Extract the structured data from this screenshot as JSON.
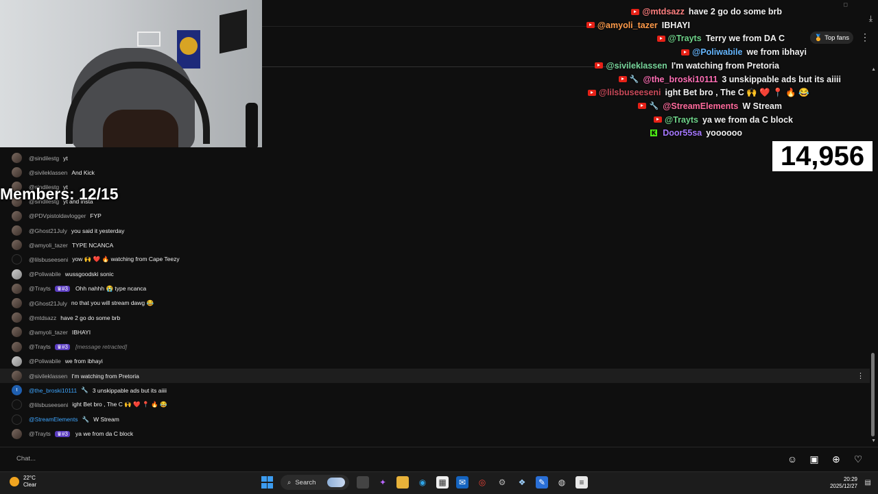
{
  "overlay": {
    "rows": [
      {
        "icon": "yt",
        "wrench": false,
        "name": "@mtdsazz",
        "name_color": "#ff8080",
        "text": "have 2 go do some brb"
      },
      {
        "icon": "yt",
        "wrench": false,
        "name": "@amyoli_tazer",
        "name_color": "#ff9b4a",
        "text": "IBHAYI"
      },
      {
        "icon": "yt",
        "wrench": false,
        "name": "@Trayts",
        "name_color": "#6fd38a",
        "text": "Terry we from DA C"
      },
      {
        "icon": "yt",
        "wrench": false,
        "name": "@Poliwabile",
        "name_color": "#66b7ff",
        "text": "we from ibhayi"
      },
      {
        "icon": "yt",
        "wrench": false,
        "name": "@sivileklassen",
        "name_color": "#77d49a",
        "text": "I'm watching from Pretoria"
      },
      {
        "icon": "yt",
        "wrench": true,
        "name": "@the_broski10111",
        "name_color": "#ff6fb5",
        "text": "3 unskippable ads but its aiiii"
      },
      {
        "icon": "yt",
        "wrench": false,
        "name": "@lilsbuseeseni",
        "name_color": "#c94a5a",
        "text": "ight Bet bro , The C 🙌 ❤️ 📍 🔥 😂"
      },
      {
        "icon": "yt",
        "wrench": true,
        "name": "@StreamElements",
        "name_color": "#ff6b9d",
        "text": "W Stream"
      },
      {
        "icon": "yt",
        "wrench": false,
        "name": "@Trayts",
        "name_color": "#6fd38a",
        "text": "ya we from da C block"
      },
      {
        "icon": "kick",
        "wrench": false,
        "name": "Door55sa",
        "name_color": "#a678ff",
        "text": "yoooooo"
      }
    ],
    "top_fans_label": "Top fans",
    "viewer_count": "14,956",
    "members_label": "Members: 12/15"
  },
  "chat": {
    "messages": [
      {
        "avatar": "photo",
        "author": "@sindilestg",
        "author_style": "grey",
        "badge": "",
        "wrench": false,
        "text": "yt",
        "italic": false
      },
      {
        "avatar": "photo",
        "author": "@sivileklassen",
        "author_style": "grey",
        "badge": "",
        "wrench": false,
        "text": "And Kick",
        "italic": false
      },
      {
        "avatar": "photo",
        "author": "@sindilestg",
        "author_style": "grey",
        "badge": "",
        "wrench": false,
        "text": "yt",
        "italic": false
      },
      {
        "avatar": "photo",
        "author": "@sindilestg",
        "author_style": "grey",
        "badge": "",
        "wrench": false,
        "text": "yt and insta",
        "italic": false
      },
      {
        "avatar": "photo",
        "author": "@PDVpistoldavlogger",
        "author_style": "grey",
        "badge": "",
        "wrench": false,
        "text": "FYP",
        "italic": false
      },
      {
        "avatar": "photo",
        "author": "@Ghost21July",
        "author_style": "grey",
        "badge": "",
        "wrench": false,
        "text": "you said it yesterday",
        "italic": false
      },
      {
        "avatar": "photo",
        "author": "@amyoli_tazer",
        "author_style": "grey",
        "badge": "",
        "wrench": false,
        "text": "TYPE NCANCA",
        "italic": false
      },
      {
        "avatar": "dark",
        "author": "@lilsbuseeseni",
        "author_style": "grey",
        "badge": "",
        "wrench": false,
        "text": "yow 🙌 ❤️ 🔥 watching from Cape Teezy",
        "italic": false
      },
      {
        "avatar": "grey",
        "author": "@Poliwabile",
        "author_style": "grey",
        "badge": "",
        "wrench": false,
        "text": "wussgoodski sonic",
        "italic": false
      },
      {
        "avatar": "photo",
        "author": "@Trayts",
        "author_style": "grey",
        "badge": "♛#3",
        "wrench": false,
        "text": "Ohh nahhh 😭 type ncanca",
        "italic": false
      },
      {
        "avatar": "photo",
        "author": "@Ghost21July",
        "author_style": "grey",
        "badge": "",
        "wrench": false,
        "text": "no that you will stream dawg 😂",
        "italic": false
      },
      {
        "avatar": "photo",
        "author": "@mtdsazz",
        "author_style": "grey",
        "badge": "",
        "wrench": false,
        "text": "have 2 go do some brb",
        "italic": false
      },
      {
        "avatar": "photo",
        "author": "@amyoli_tazer",
        "author_style": "grey",
        "badge": "",
        "wrench": false,
        "text": "IBHAYI",
        "italic": false
      },
      {
        "avatar": "photo",
        "author": "@Trayts",
        "author_style": "grey",
        "badge": "♛#3",
        "wrench": false,
        "text": "[message retracted]",
        "italic": true
      },
      {
        "avatar": "grey",
        "author": "@Poliwabile",
        "author_style": "grey",
        "badge": "",
        "wrench": false,
        "text": "we from ibhayi",
        "italic": false
      },
      {
        "avatar": "photo",
        "author": "@sivileklassen",
        "author_style": "grey",
        "badge": "",
        "wrench": false,
        "text": "I'm watching from Pretoria",
        "italic": false
      },
      {
        "avatar": "blue",
        "author": "@the_broski10111",
        "author_style": "blue",
        "badge": "",
        "wrench": true,
        "text": "3 unskippable ads but its aiiii",
        "italic": false
      },
      {
        "avatar": "dark",
        "author": "@lilsbuseeseni",
        "author_style": "grey",
        "badge": "",
        "wrench": false,
        "text": "ight Bet bro , The C 🙌 ❤️ 📍 🔥 😂",
        "italic": false
      },
      {
        "avatar": "dark",
        "author": "@StreamElements",
        "author_style": "blue",
        "badge": "",
        "wrench": true,
        "text": "W Stream",
        "italic": false
      },
      {
        "avatar": "photo",
        "author": "@Trayts",
        "author_style": "grey",
        "badge": "♛#3",
        "wrench": false,
        "text": "ya we from da C block",
        "italic": false
      }
    ],
    "input_placeholder": "Chat..."
  },
  "taskbar": {
    "weather_temp": "22°C",
    "weather_desc": "Clear",
    "search_label": "Search",
    "time": "20:29",
    "date": "2025/12/27"
  }
}
